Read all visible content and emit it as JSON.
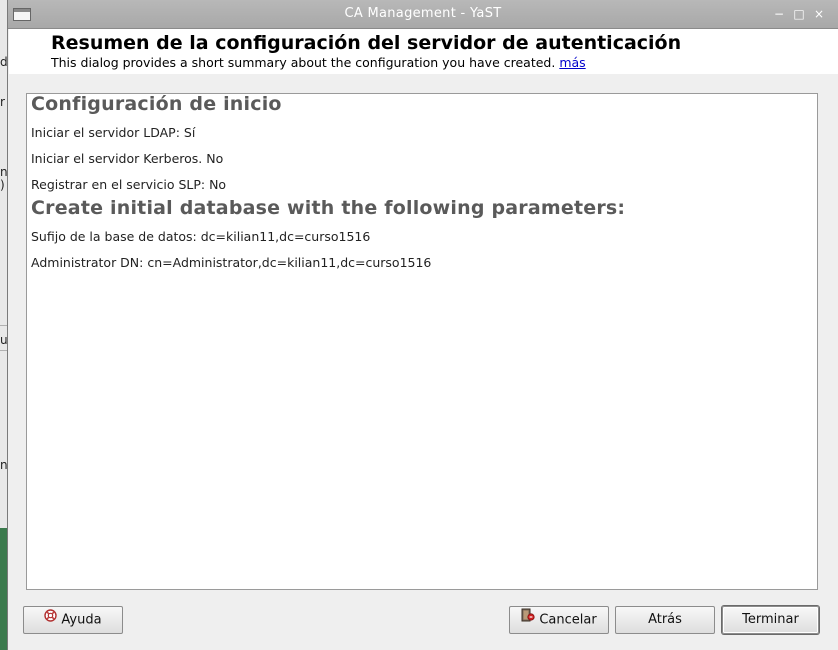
{
  "window": {
    "title": "CA Management - YaST",
    "controls": {
      "minimize": "−",
      "maximize": "□",
      "close": "×"
    }
  },
  "header": {
    "heading": "Resumen de la configuración del servidor de autenticación",
    "description": "This dialog provides a short summary about the configuration you have created.",
    "more_link": "más"
  },
  "summary": {
    "section1_title": "Configuración de inicio",
    "section1_items": [
      "Iniciar el servidor LDAP: Sí",
      "Iniciar el servidor Kerberos. No",
      "Registrar en el servicio SLP: No"
    ],
    "section2_title": "Create initial database with the following parameters:",
    "section2_items": [
      "Sufijo de la base de datos: dc=kilian11,dc=curso1516",
      "Administrator DN: cn=Administrator,dc=kilian11,dc=curso1516"
    ]
  },
  "buttons": {
    "help": "Ayuda",
    "cancel": "Cancelar",
    "back": "Atrás",
    "finish": "Terminar"
  },
  "background_window": {
    "fragments": [
      "r",
      "d",
      "n",
      ")",
      "u",
      "n"
    ]
  },
  "icons": {
    "help": "help-lifebuoy-icon",
    "cancel": "cancel-exit-icon",
    "app": "window-icon"
  }
}
